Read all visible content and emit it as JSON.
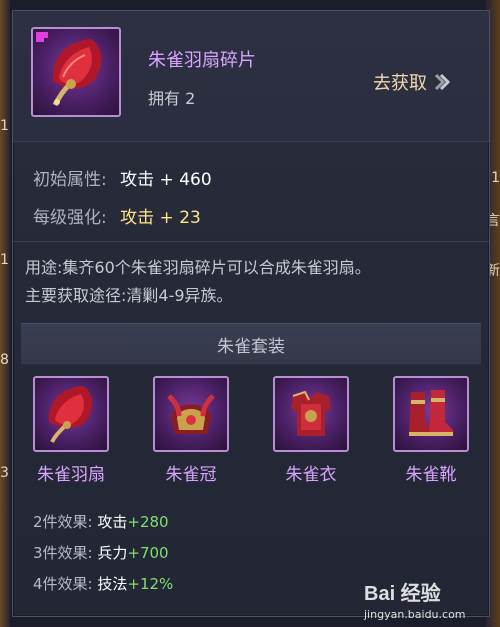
{
  "item": {
    "name": "朱雀羽扇碎片",
    "owned": "拥有 2",
    "get_label": "去获取",
    "get_icon": "chevron-right-icon"
  },
  "attributes": [
    {
      "label": "初始属性:",
      "value": "攻击 + 460"
    },
    {
      "label": "每级强化:",
      "value": "攻击 + 23"
    }
  ],
  "description": {
    "usage": "用途:集齐60个朱雀羽扇碎片可以合成朱雀羽扇。",
    "source": "主要获取途径:清剿4-9异族。"
  },
  "suit": {
    "title": "朱雀套装",
    "items": [
      {
        "name": "朱雀羽扇",
        "icon": "feather-fan-icon"
      },
      {
        "name": "朱雀冠",
        "icon": "helmet-icon"
      },
      {
        "name": "朱雀衣",
        "icon": "armor-icon"
      },
      {
        "name": "朱雀靴",
        "icon": "boots-icon"
      }
    ],
    "effects": [
      {
        "label": "2件效果:",
        "stat": "攻击",
        "bonus": "+280"
      },
      {
        "label": "3件效果:",
        "stat": "兵力",
        "bonus": "+700"
      },
      {
        "label": "4件效果:",
        "stat": "技法",
        "bonus": "+12%"
      }
    ]
  },
  "watermark": {
    "brand": "Bai 经验",
    "url": "jingyan.baidu.com"
  },
  "edge_glyphs": [
    "1",
    "1",
    "8",
    "3",
    "1",
    "言",
    "新"
  ],
  "colors": {
    "item_name": "#d8a5ff",
    "bonus_green": "#7ee06e",
    "per_level_yellow": "#ffe58a",
    "frame_purple": "#b68fd0"
  }
}
